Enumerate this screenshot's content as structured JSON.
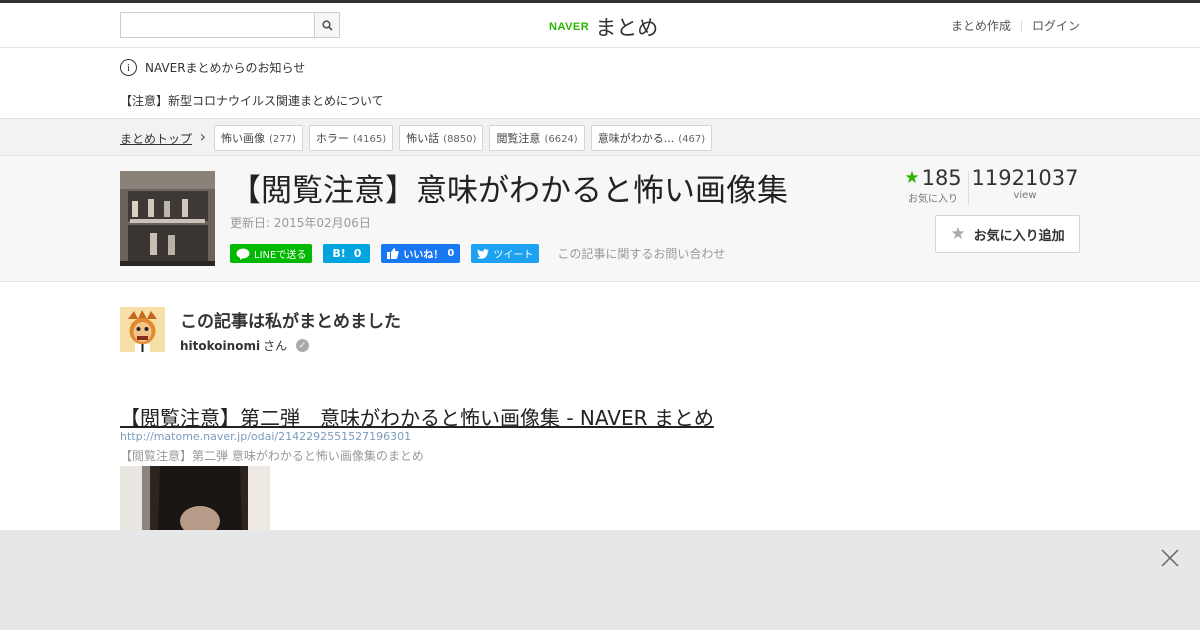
{
  "header": {
    "logo_brand": "NAVER",
    "logo_text": "まとめ",
    "search_placeholder": "",
    "create_link": "まとめ作成",
    "login_link": "ログイン"
  },
  "notice": {
    "heading": "NAVERまとめからのお知らせ",
    "item": "【注意】新型コロナウイルス関連まとめについて"
  },
  "breadcrumb": {
    "top": "まとめトップ",
    "tags": [
      {
        "label": "怖い画像",
        "count": "(277)"
      },
      {
        "label": "ホラー",
        "count": "(4165)"
      },
      {
        "label": "怖い話",
        "count": "(8850)"
      },
      {
        "label": "閲覧注意",
        "count": "(6624)"
      },
      {
        "label": "意味がわかる...",
        "count": "(467)"
      }
    ]
  },
  "article": {
    "title": "【閲覧注意】意味がわかると怖い画像集",
    "updated": "更新日: 2015年02月06日",
    "share": {
      "line": "LINEで送る",
      "hatena_count": "0",
      "fb_label": "いいね！",
      "fb_count": "0",
      "tweet": "ツイート"
    },
    "contact": "この記事に関するお問い合わせ",
    "favorites": "185",
    "favorites_label": "お気に入り",
    "views": "11921037",
    "views_label": "view",
    "fav_button": "お気に入り追加"
  },
  "author": {
    "heading": "この記事は私がまとめました",
    "name": "hitokoinomi",
    "suffix": "さん"
  },
  "link": {
    "title": "【閲覧注意】第二弾　意味がわかると怖い画像集 - NAVER まとめ",
    "url": "http://matome.naver.jp/odai/2142292551527196301",
    "description": "【閲覧注意】第二弾 意味がわかると怖い画像集のまとめ"
  },
  "colors": {
    "brand": "#2db400",
    "line": "#00b900",
    "hatena": "#00a4de",
    "facebook": "#1877f2",
    "twitter": "#1da1f2"
  }
}
